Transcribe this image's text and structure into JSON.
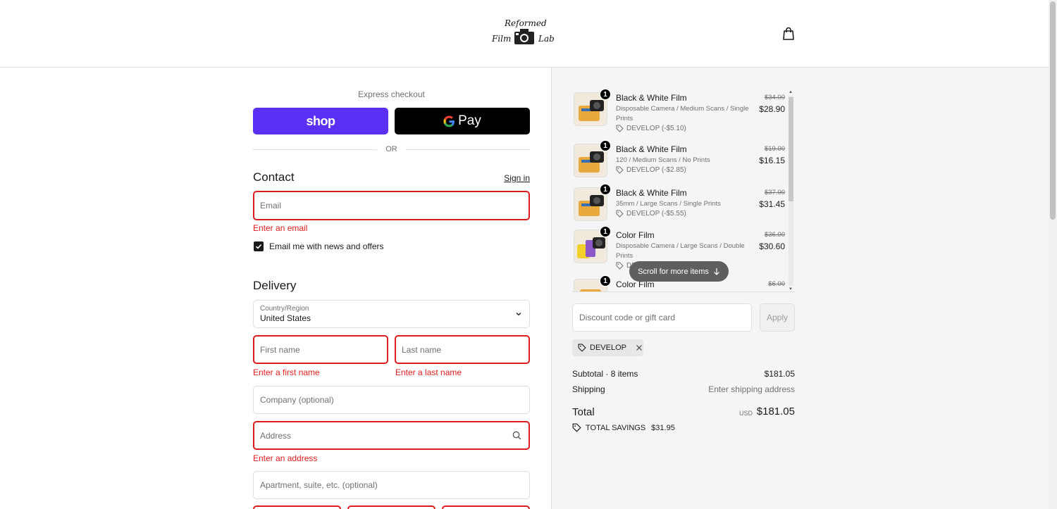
{
  "header": {
    "logo": {
      "line1": "Reformed",
      "line2": "Film",
      "line3": "Lab"
    },
    "cart_icon": "shopping-bag-icon"
  },
  "express": {
    "label": "Express checkout",
    "shop_label": "shop",
    "gpay_label": "Pay",
    "or_label": "OR"
  },
  "contact": {
    "title": "Contact",
    "sign_in": "Sign in",
    "email_placeholder": "Email",
    "email_error": "Enter an email",
    "newsletter_label": "Email me with news and offers",
    "newsletter_checked": true
  },
  "delivery": {
    "title": "Delivery",
    "country_label": "Country/Region",
    "country_value": "United States",
    "first_name_placeholder": "First name",
    "first_name_error": "Enter a first name",
    "last_name_placeholder": "Last name",
    "last_name_error": "Enter a last name",
    "company_placeholder": "Company (optional)",
    "address_placeholder": "Address",
    "address_error": "Enter an address",
    "apartment_placeholder": "Apartment, suite, etc. (optional)"
  },
  "summary": {
    "items": [
      {
        "qty": "1",
        "name": "Black & White Film",
        "variant": "Disposable Camera / Medium Scans / Single Prints",
        "discount": "DEVELOP (-$5.10)",
        "old_price": "$34.00",
        "price": "$28.90"
      },
      {
        "qty": "1",
        "name": "Black & White Film",
        "variant": "120 / Medium Scans / No Prints",
        "discount": "DEVELOP (-$2.85)",
        "old_price": "$19.00",
        "price": "$16.15"
      },
      {
        "qty": "1",
        "name": "Black & White Film",
        "variant": "35mm / Large Scans / Single Prints",
        "discount": "DEVELOP (-$5.55)",
        "old_price": "$37.00",
        "price": "$31.45"
      },
      {
        "qty": "1",
        "name": "Color Film",
        "variant": "Disposable Camera / Large Scans / Double Prints",
        "discount": "DEVELOP",
        "old_price": "$36.00",
        "price": "$30.60"
      },
      {
        "qty": "1",
        "name": "Color Film",
        "variant": "",
        "discount": "",
        "old_price": "$6.00",
        "price": ""
      }
    ],
    "scroll_hint": "Scroll for more items",
    "discount_placeholder": "Discount code or gift card",
    "apply_label": "Apply",
    "applied_code": "DEVELOP",
    "subtotal_label": "Subtotal · 8 items",
    "subtotal_value": "$181.05",
    "shipping_label": "Shipping",
    "shipping_value": "Enter shipping address",
    "total_label": "Total",
    "currency": "USD",
    "total_value": "$181.05",
    "savings_label": "TOTAL SAVINGS",
    "savings_value": "$31.95"
  },
  "colors": {
    "shop_purple": "#5a31f4",
    "error_red": "#dd1d1d",
    "panel_bg": "#f5f5f5"
  }
}
